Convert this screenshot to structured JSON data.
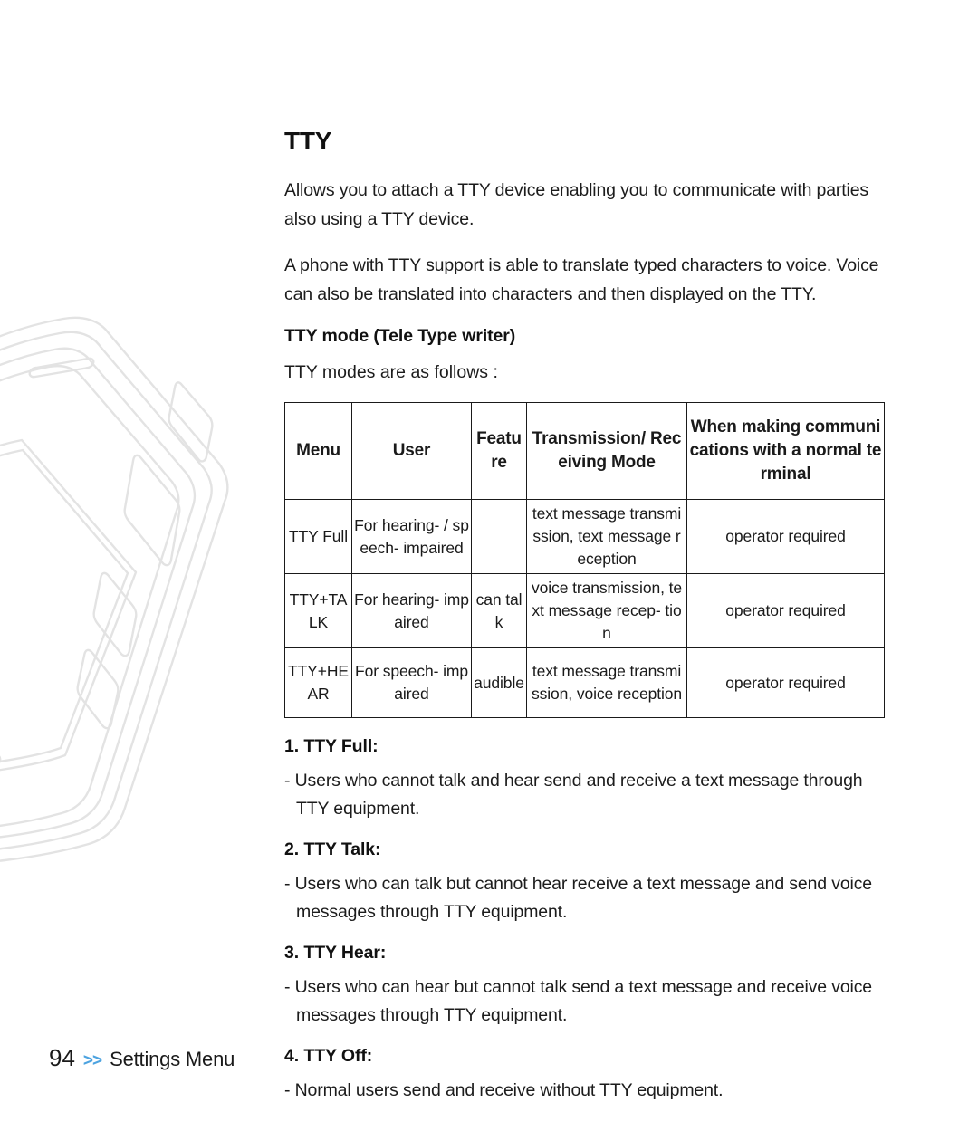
{
  "page": {
    "title": "TTY",
    "intro_paragraphs": [
      "Allows you to attach a TTY device enabling you to communicate with parties also using a TTY device.",
      "A phone with TTY support is able to translate typed characters to voice. Voice can also be translated into characters and then displayed on the TTY."
    ],
    "subheading": "TTY mode (Tele Type writer)",
    "lead_in": "TTY modes are as follows :"
  },
  "table": {
    "headers": {
      "menu": "Menu",
      "user": "User",
      "feature": "Feature",
      "transmission": "Transmission/ Receiving Mode",
      "when_making": "When making communications with a normal terminal"
    },
    "rows": [
      {
        "menu": "TTY Full",
        "user": "For hearing- / speech- impaired",
        "feature": "",
        "transmission": "text message transmission, text message reception",
        "when_making": "operator required"
      },
      {
        "menu": "TTY+TALK",
        "user": "For hearing- impaired",
        "feature": "can talk",
        "transmission": "voice transmission, text message recep- tion",
        "when_making": "operator required"
      },
      {
        "menu": "TTY+HEAR",
        "user": "For speech- impaired",
        "feature": "audible",
        "transmission": "text message transmission, voice reception",
        "when_making": "operator required"
      }
    ]
  },
  "modes": [
    {
      "heading": "1. TTY Full:",
      "body": "- Users who cannot talk and hear send and receive a text message through TTY equipment."
    },
    {
      "heading": "2. TTY Talk:",
      "body": "- Users who can talk but cannot hear receive a text message and send voice messages through TTY equipment."
    },
    {
      "heading": "3. TTY Hear:",
      "body": "- Users who can hear but cannot talk send a text message and receive voice messages through TTY equipment."
    },
    {
      "heading": "4. TTY Off:",
      "body": "- Normal users send and receive without TTY equipment."
    }
  ],
  "footer": {
    "page_number": "94",
    "chevrons": ">>",
    "section": "Settings Menu",
    "chevron_color": "#4da3e0"
  }
}
